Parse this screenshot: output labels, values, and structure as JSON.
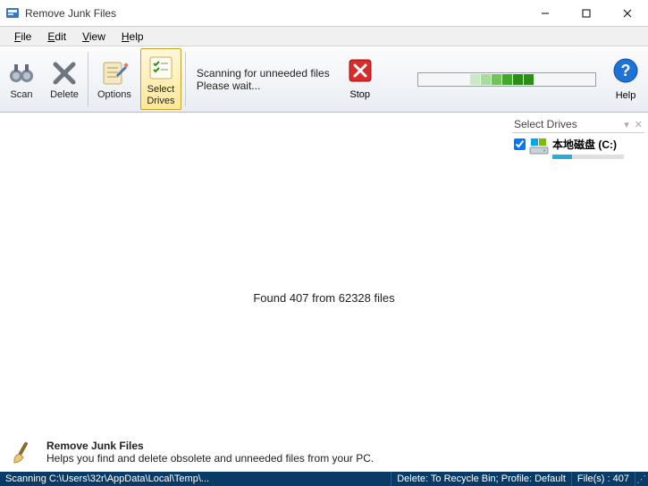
{
  "window": {
    "title": "Remove Junk Files"
  },
  "menu": {
    "file": "File",
    "edit": "Edit",
    "view": "View",
    "help": "Help"
  },
  "toolbar": {
    "scan": "Scan",
    "delete": "Delete",
    "options": "Options",
    "select_drives": "Select\nDrives",
    "status_line1": "Scanning for unneeded files",
    "status_line2": "Please wait...",
    "stop": "Stop",
    "help": "Help"
  },
  "main": {
    "found_text": "Found 407 from 62328 files"
  },
  "drives": {
    "title": "Select Drives",
    "items": [
      {
        "label": "本地磁盘 (C:)",
        "checked": true,
        "fill_pct": 28
      }
    ]
  },
  "footer": {
    "title": "Remove Junk Files",
    "subtitle": "Helps you find and delete obsolete and unneeded files from your PC."
  },
  "statusbar": {
    "scanning": "Scanning C:\\Users\\32r\\AppData\\Local\\Temp\\...",
    "delete_mode": "Delete: To Recycle Bin; Profile: Default",
    "files": "File(s) : 407"
  },
  "progress": {
    "cells": [
      "#cde8c6",
      "#a9dba0",
      "#6fc45b",
      "#3faa2a",
      "#2a8f18",
      "#2a8f18"
    ]
  }
}
